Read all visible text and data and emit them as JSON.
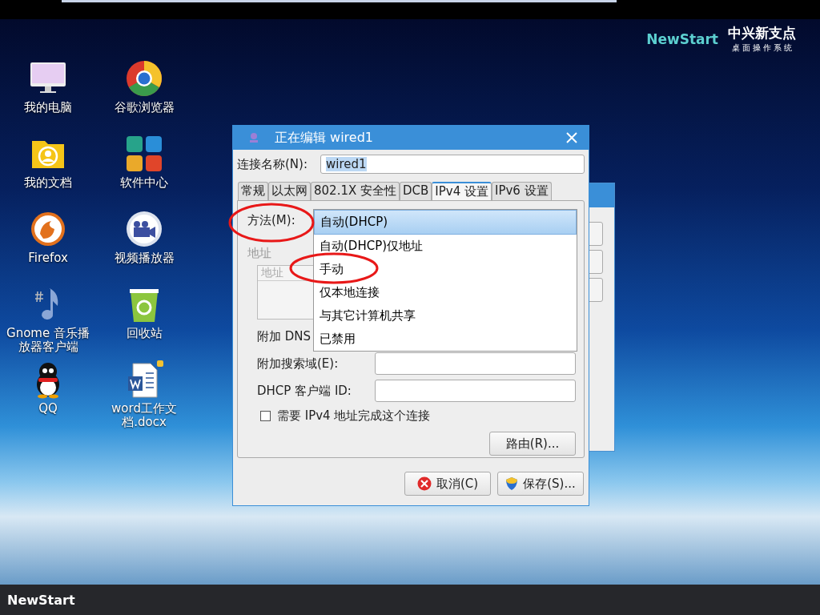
{
  "branding": {
    "logo": "NewStart",
    "title": "中兴新支点",
    "subtitle": "桌 面 操 作 系 统"
  },
  "desktop_icons": [
    {
      "label": "我的电脑",
      "kind": "computer"
    },
    {
      "label": "谷歌浏览器",
      "kind": "browser"
    },
    {
      "label": "我的文档",
      "kind": "folder"
    },
    {
      "label": "软件中心",
      "kind": "store"
    },
    {
      "label": "Firefox",
      "kind": "firefox"
    },
    {
      "label": "视频播放器",
      "kind": "video"
    },
    {
      "label": "Gnome 音乐播放器客户端",
      "kind": "music"
    },
    {
      "label": "回收站",
      "kind": "trash"
    },
    {
      "label": "QQ",
      "kind": "qq"
    },
    {
      "label": "word工作文档.docx",
      "kind": "word"
    }
  ],
  "dialog": {
    "title": "正在编辑 wired1",
    "name_label": "连接名称(N):",
    "name_value": "wired1",
    "tabs": [
      {
        "label": "常规",
        "selected": false
      },
      {
        "label": "以太网",
        "selected": false
      },
      {
        "label": "802.1X 安全性",
        "selected": false
      },
      {
        "label": "DCB",
        "selected": false
      },
      {
        "label": "IPv4 设置",
        "selected": true
      },
      {
        "label": "IPv6 设置",
        "selected": false
      }
    ],
    "method_label": "方法(M):",
    "address_label": "地址",
    "address_column": "地址",
    "dns_label": "附加 DNS",
    "search_label": "附加搜索域(E):",
    "dhcp_label": "DHCP 客户端 ID:",
    "require_checkbox": {
      "label": "需要 IPv4 地址完成这个连接",
      "checked": false
    },
    "routes_button": "路由(R)...",
    "buttons": [
      {
        "label": "取消(C)",
        "kind": "cancel"
      },
      {
        "label": "保存(S)...",
        "kind": "save"
      }
    ]
  },
  "method_menu": [
    {
      "label": "自动(DHCP)",
      "selected": true
    },
    {
      "label": "自动(DHCP)仅地址",
      "selected": false
    },
    {
      "label": "手动",
      "selected": false
    },
    {
      "label": "仅本地连接",
      "selected": false
    },
    {
      "label": "与其它计算机共享",
      "selected": false
    },
    {
      "label": "已禁用",
      "selected": false
    }
  ],
  "taskbar": {
    "logo": "NewStart"
  }
}
